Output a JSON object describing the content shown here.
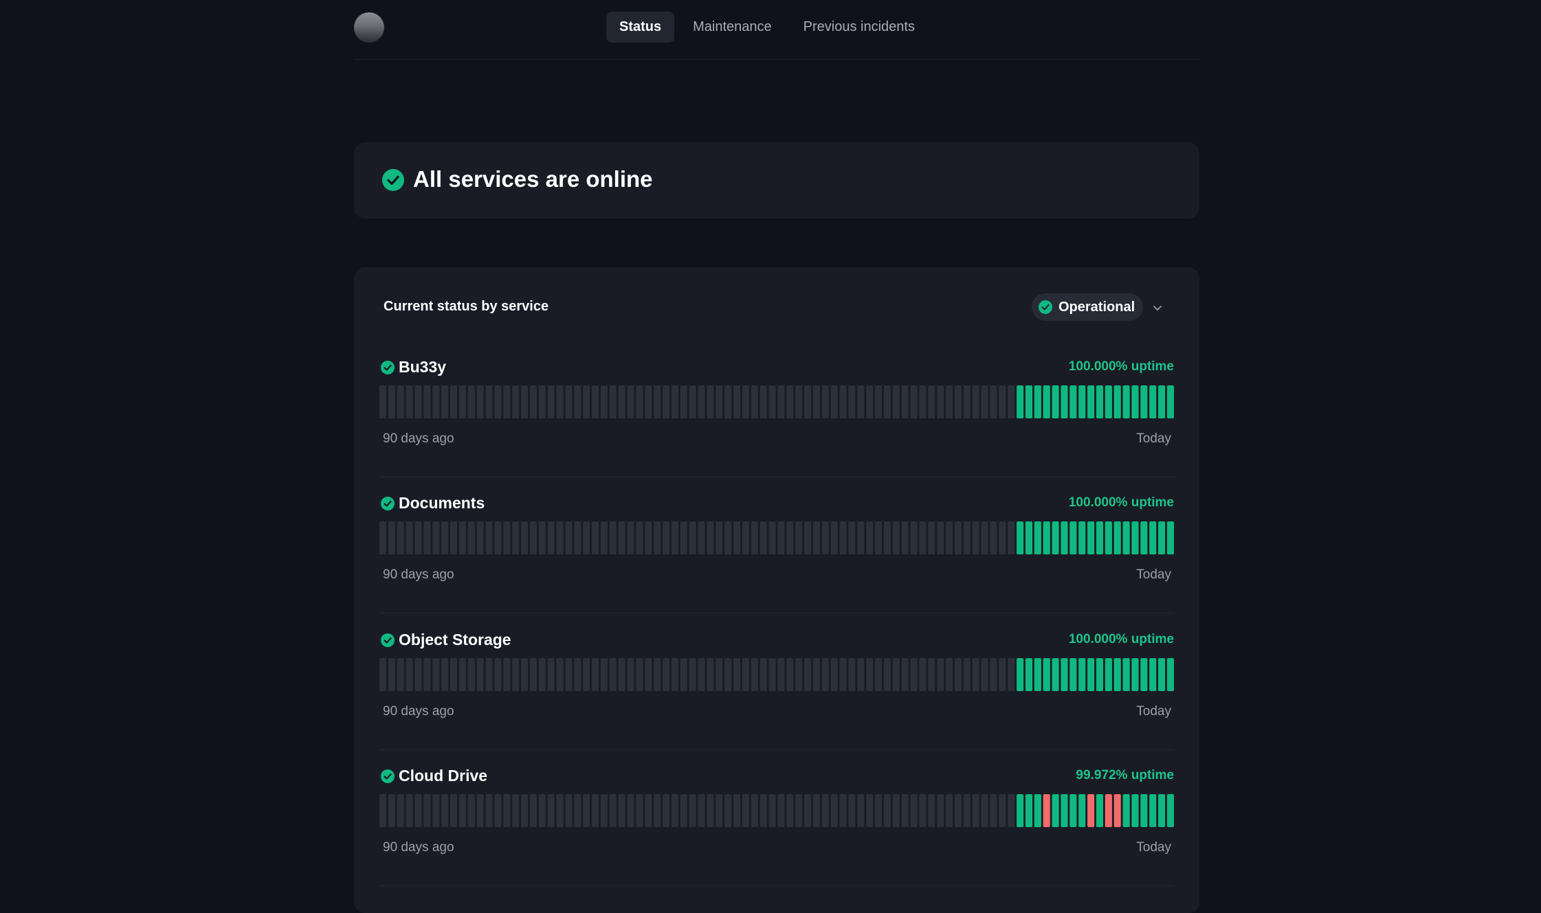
{
  "colors": {
    "operational": "#10b981",
    "outage": "#f26b6b",
    "no_data": "#2c303a",
    "uptime_text": "#1fc48a"
  },
  "header": {
    "logo_icon": "logo-circle",
    "tabs": [
      {
        "label": "Status",
        "active": true
      },
      {
        "label": "Maintenance",
        "active": false
      },
      {
        "label": "Previous incidents",
        "active": false
      }
    ]
  },
  "banner": {
    "icon": "check-circle-icon",
    "title": "All services are online"
  },
  "status_panel": {
    "title": "Current status by service",
    "filter_label": "Operational",
    "filter_icon": "check-circle-icon",
    "dropdown_icon": "chevron-down-icon",
    "history_days": 90,
    "services": [
      {
        "name": "Bu33y",
        "uptime": "100.000% uptime",
        "start_label": "90 days ago",
        "end_label": "Today",
        "days": "nnnnnnnnnnnnnnnnnnnnnnnnnnnnnnnnnnnnnnnnnnnnnnnnnnnnnnnnnnnnnnnnnnnnnnnnoooooooooooooooooo"
      },
      {
        "name": "Documents",
        "uptime": "100.000% uptime",
        "start_label": "90 days ago",
        "end_label": "Today",
        "days": "nnnnnnnnnnnnnnnnnnnnnnnnnnnnnnnnnnnnnnnnnnnnnnnnnnnnnnnnnnnnnnnnnnnnnnnnoooooooooooooooooo"
      },
      {
        "name": "Object Storage",
        "uptime": "100.000% uptime",
        "start_label": "90 days ago",
        "end_label": "Today",
        "days": "nnnnnnnnnnnnnnnnnnnnnnnnnnnnnnnnnnnnnnnnnnnnnnnnnnnnnnnnnnnnnnnnnnnnnnnnoooooooooooooooooo"
      },
      {
        "name": "Cloud Drive",
        "uptime": "99.972% uptime",
        "start_label": "90 days ago",
        "end_label": "Today",
        "days": "nnnnnnnnnnnnnnnnnnnnnnnnnnnnnnnnnnnnnnnnnnnnnnnnnnnnnnnnnnnnnnnnnnnnnnnnooodoooododdoooooo"
      }
    ]
  }
}
